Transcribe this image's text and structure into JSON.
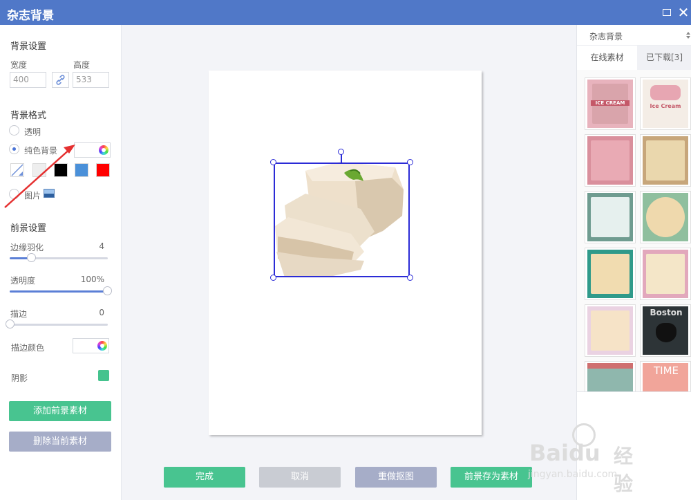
{
  "window": {
    "title": "杂志背景",
    "maximize_icon": "maximize-icon",
    "close_glyph": "✕"
  },
  "left": {
    "bg_settings_title": "背景设置",
    "width_label": "宽度",
    "height_label": "高度",
    "width_value": "400",
    "height_value": "533",
    "bg_format_title": "背景格式",
    "opt_transparent": "透明",
    "opt_solid": "纯色背景",
    "opt_image": "图片",
    "selected_format": "纯色背景",
    "swatch_colors": [
      "#ffffff",
      "#eeeeee",
      "#000000",
      "#4a90d9",
      "#ff0000"
    ],
    "fg_settings_title": "前景设置",
    "feather_label": "边缘羽化",
    "feather_value": "4",
    "feather_level": 0.22,
    "opacity_label": "透明度",
    "opacity_value": "100%",
    "opacity_level": 1.0,
    "stroke_label": "描边",
    "stroke_value": "0",
    "stroke_level": 0.0,
    "stroke_color_label": "描边颜色",
    "shadow_label": "阴影",
    "shadow_color": "#45c38e",
    "add_fg_button": "添加前景素材",
    "delete_fg_button": "删除当前素材",
    "accent_green": "#48c490",
    "gray_button": "#a6adc8"
  },
  "bottom": {
    "done": "完成",
    "cancel": "取消",
    "redo_cutout": "重做抠图",
    "save_fg": "前景存为素材"
  },
  "right": {
    "dropdown_value": "杂志背景",
    "tab_online": "在线素材",
    "tab_downloaded": "已下载[3]",
    "thumb_texts": [
      "ICE CREAM",
      "Ice Cream",
      "",
      "",
      "",
      "",
      "",
      "",
      "Boston",
      "TIME"
    ]
  },
  "watermark": {
    "brand": "Baidu",
    "brand_cn": "经验",
    "url": "jingyan.baidu.com"
  }
}
